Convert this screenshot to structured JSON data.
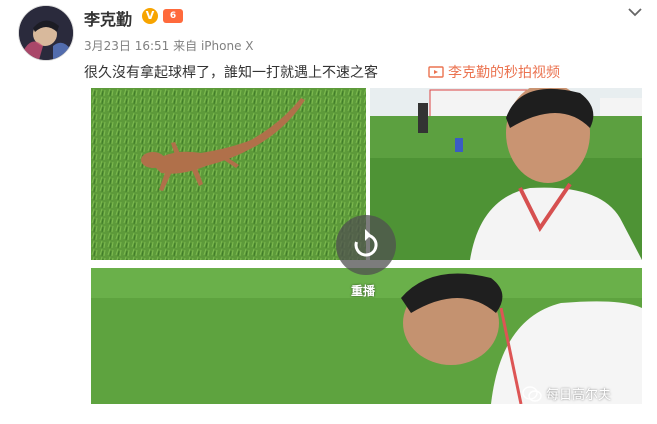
{
  "post": {
    "username": "李克勤",
    "verified_badge": "V",
    "vip_level": "6",
    "timestamp": "3月23日 16:51",
    "source": "来自 iPhone X",
    "text": "很久沒有拿起球桿了，誰知一打就遇上不速之客",
    "video_link": "李克勤的秒拍视频"
  },
  "player": {
    "replay_label": "重播",
    "watermark": "每日高尔夫"
  },
  "icons": {
    "menu": "chevron-down-icon",
    "video": "video-icon",
    "replay": "replay-icon",
    "watermark": "wechat-icon"
  },
  "colors": {
    "link": "#eb7350",
    "meta": "#808080",
    "badge": "#f7a400"
  }
}
